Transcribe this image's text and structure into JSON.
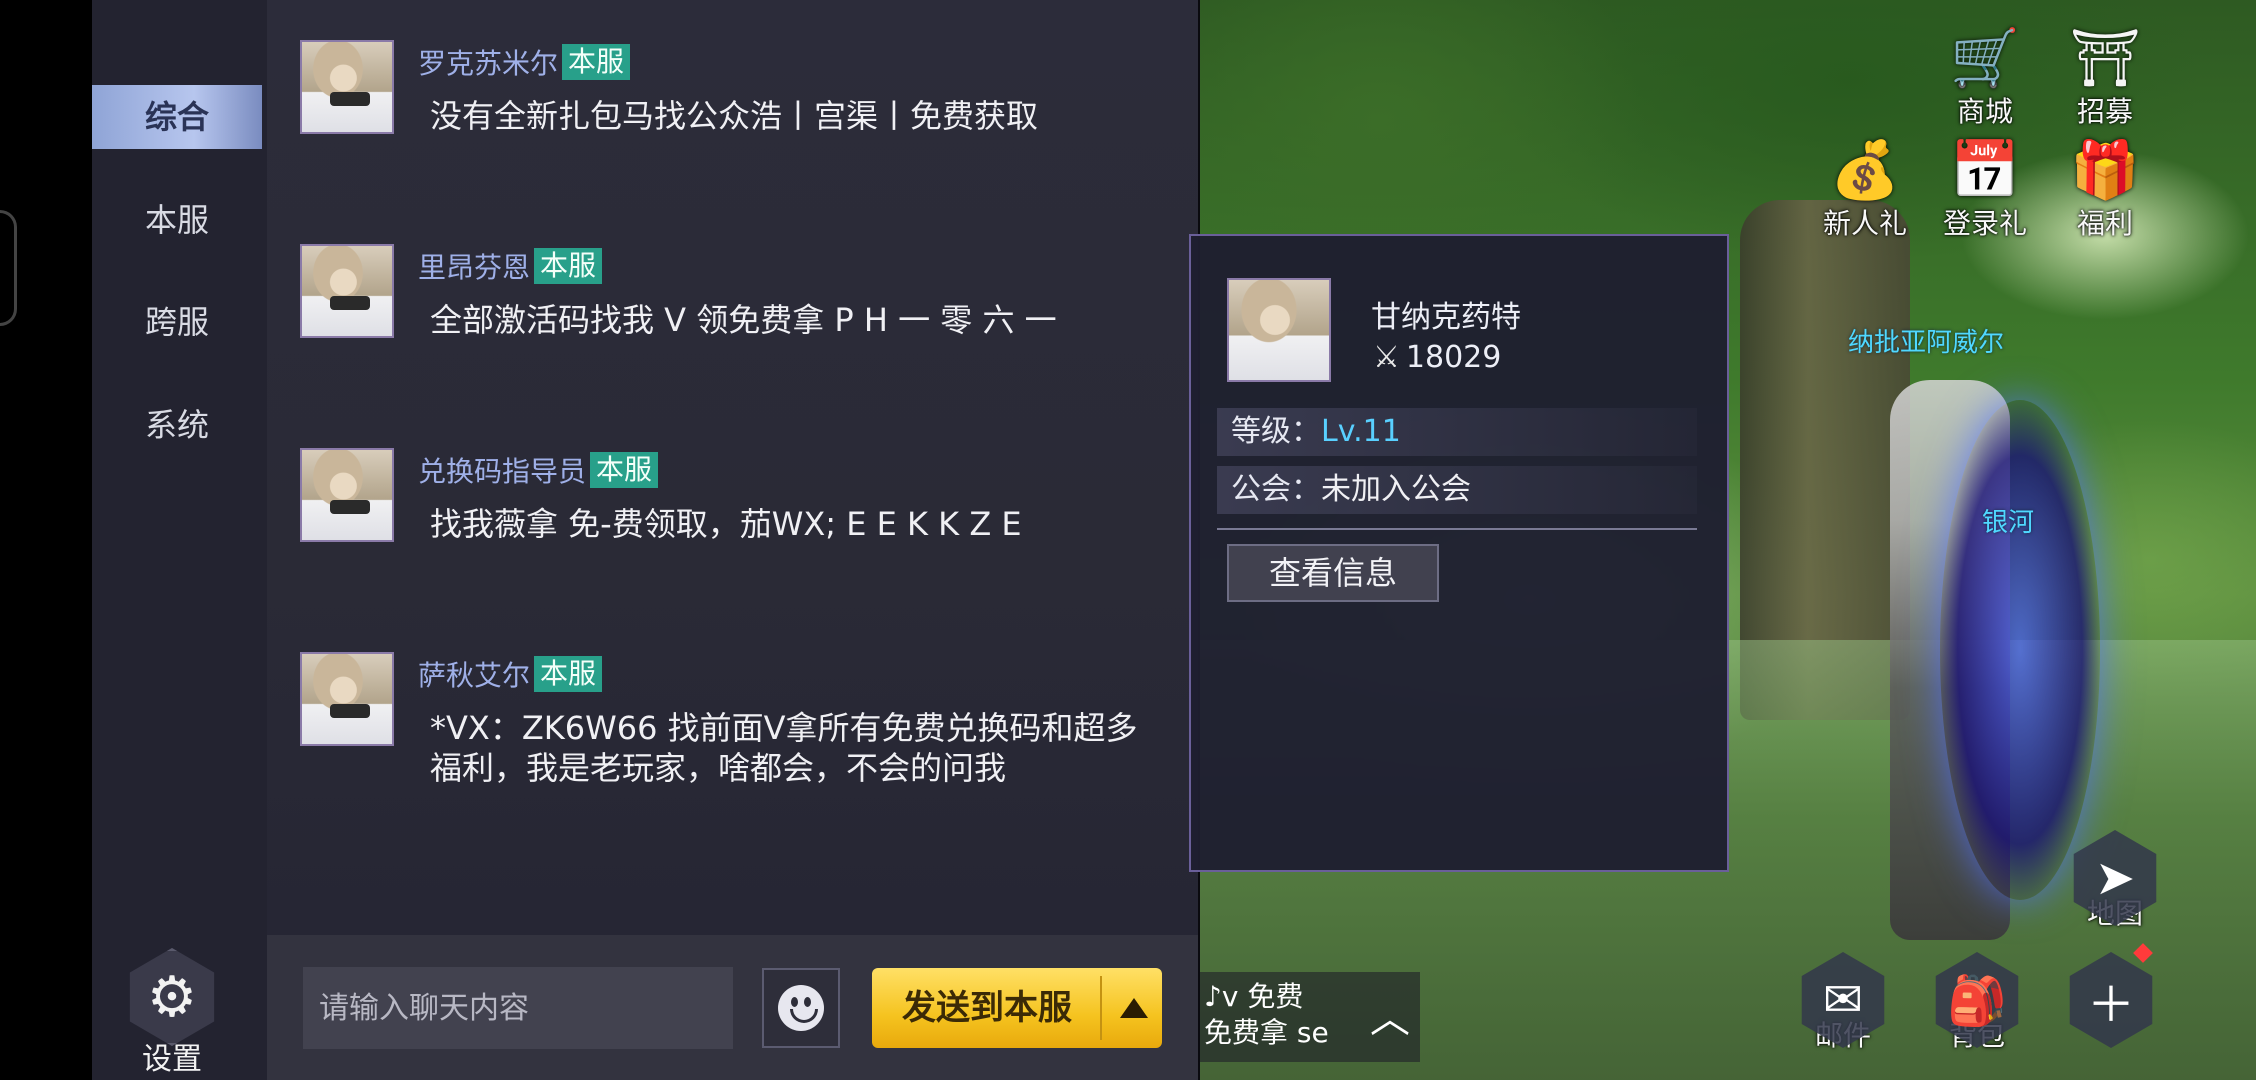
{
  "chat": {
    "tabs": [
      "综合",
      "本服",
      "跨服",
      "系统"
    ],
    "active_tab": 0,
    "settings_label": "设置",
    "messages": [
      {
        "sender": "罗克苏米尔",
        "tag": "本服",
        "text": "没有全新扎包马找公众浩丨宫渠丨免费获取"
      },
      {
        "sender": "里昂芬恩",
        "tag": "本服",
        "text": "全部激活码找我 V 领免费拿 P H 一  零 六 一"
      },
      {
        "sender": "兑换码指导员",
        "tag": "本服",
        "text": "找我薇拿 免-费领取，茄WX; E E K K Z E"
      },
      {
        "sender": "萨秋艾尔",
        "tag": "本服",
        "text": "*VX：ZK6W66  找前面V拿所有免费兑换码和超多福利，我是老玩家，啥都会，不会的问我"
      }
    ],
    "input_placeholder": "请输入聊天内容",
    "send_label": "发送到本服"
  },
  "player_info": {
    "name": "甘纳克药特",
    "power": "18029",
    "level_label": "等级：",
    "level_value": "Lv.11",
    "guild_label": "公会：",
    "guild_value": "未加入公会",
    "view_button": "查看信息"
  },
  "hud": {
    "shop": "商城",
    "recruit": "招募",
    "newbie_gift": "新人礼",
    "login_gift": "登录礼",
    "welfare": "福利",
    "map": "地图",
    "mail": "邮件",
    "bag": "背包"
  },
  "scene": {
    "npc_name": "纳批亚阿威尔",
    "player_name": "银河",
    "mini_chat_line1": "♪v 免费",
    "mini_chat_line2": "免费拿 se"
  },
  "colors": {
    "server_tag": "#28a08a",
    "level_text": "#59d0ff",
    "send_button": "#f5c31f",
    "sender_name": "#9fb0e8"
  }
}
